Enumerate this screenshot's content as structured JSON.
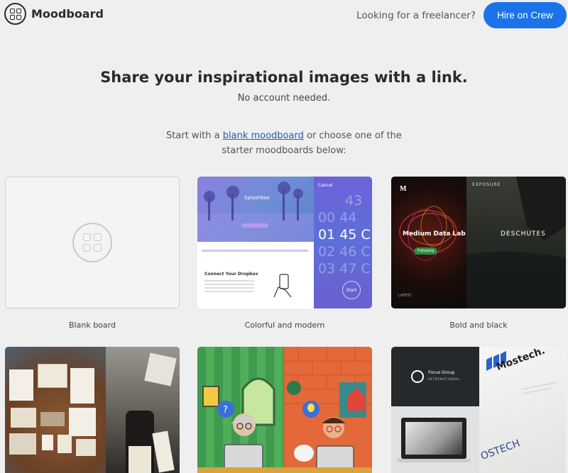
{
  "header": {
    "app_name": "Moodboard",
    "freelancer_text": "Looking for a freelancer?",
    "hire_button": "Hire on Crew"
  },
  "hero": {
    "headline": "Share your inspirational images with a link.",
    "subheadline": "No account needed."
  },
  "intro": {
    "prefix": "Start with a ",
    "link": "blank moodboard",
    "suffix_line1": " or choose one of the",
    "line2": "starter moodboards below:"
  },
  "boards": [
    {
      "label": "Blank board"
    },
    {
      "label": "Colorful and modern"
    },
    {
      "label": "Bold and black"
    },
    {
      "label": ""
    },
    {
      "label": ""
    },
    {
      "label": ""
    }
  ],
  "thumb_text": {
    "splashbox": "Splashbox",
    "cancel": "Cancel",
    "clock_rows": [
      "43",
      "00 44",
      "01 45 C",
      "02 46 C",
      "03 47 C"
    ],
    "connect_dropbox": "Connect Your Dropbox",
    "start": "Start",
    "exposure": "EXPOSURE",
    "medium_data_lab": "Medium Data Lab",
    "deschutes": "DESCHUTES",
    "following": "Following",
    "latest": "LATEST",
    "focus_group": "Focus Group",
    "international": "INTERNATIONAL",
    "mostech": "Mostech.",
    "ostech": "OSTECH"
  }
}
